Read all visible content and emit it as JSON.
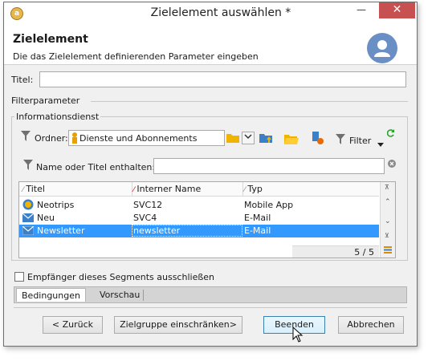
{
  "window": {
    "title": "Zielelement auswählen *",
    "close_glyph": "✕",
    "minimize_glyph": "—"
  },
  "header": {
    "title": "Zielelement",
    "subtitle": "Die das Zielelement definierenden Parameter eingeben"
  },
  "form": {
    "title_label": "Titel:",
    "title_value": "",
    "filter_section_label": "Filterparameter",
    "info_group_label": "Informationsdienst",
    "folder_label": "Ordner:",
    "folder_value": "Dienste und Abonnements",
    "filter_button_label": "Filter",
    "name_filter_label": "Name oder Titel enthalten:",
    "name_filter_value": ""
  },
  "grid": {
    "columns": [
      "Titel",
      "Interner Name",
      "Typ"
    ],
    "rows": [
      {
        "title": "Neotrips",
        "internal_name": "SVC12",
        "type": "Mobile App",
        "icon": "mobile-app-icon"
      },
      {
        "title": "Neu",
        "internal_name": "SVC4",
        "type": "E-Mail",
        "icon": "email-icon"
      },
      {
        "title": "Newsletter",
        "internal_name": "newsletter",
        "type": "E-Mail",
        "icon": "email-icon",
        "selected": true
      }
    ],
    "count": "5 / 5"
  },
  "exclude_checkbox_label": "Empfänger dieses Segments ausschließen",
  "exclude_checked": false,
  "tabs": [
    "Bedingungen",
    "Vorschau"
  ],
  "active_tab": "Bedingungen",
  "buttons": {
    "back": "< Zurück",
    "restrict": "Zielgruppe einschränken>",
    "finish": "Beenden",
    "cancel": "Abbrechen"
  },
  "colors": {
    "selection": "#3399ff",
    "close": "#c75050",
    "accent": "#3c7fb1"
  }
}
